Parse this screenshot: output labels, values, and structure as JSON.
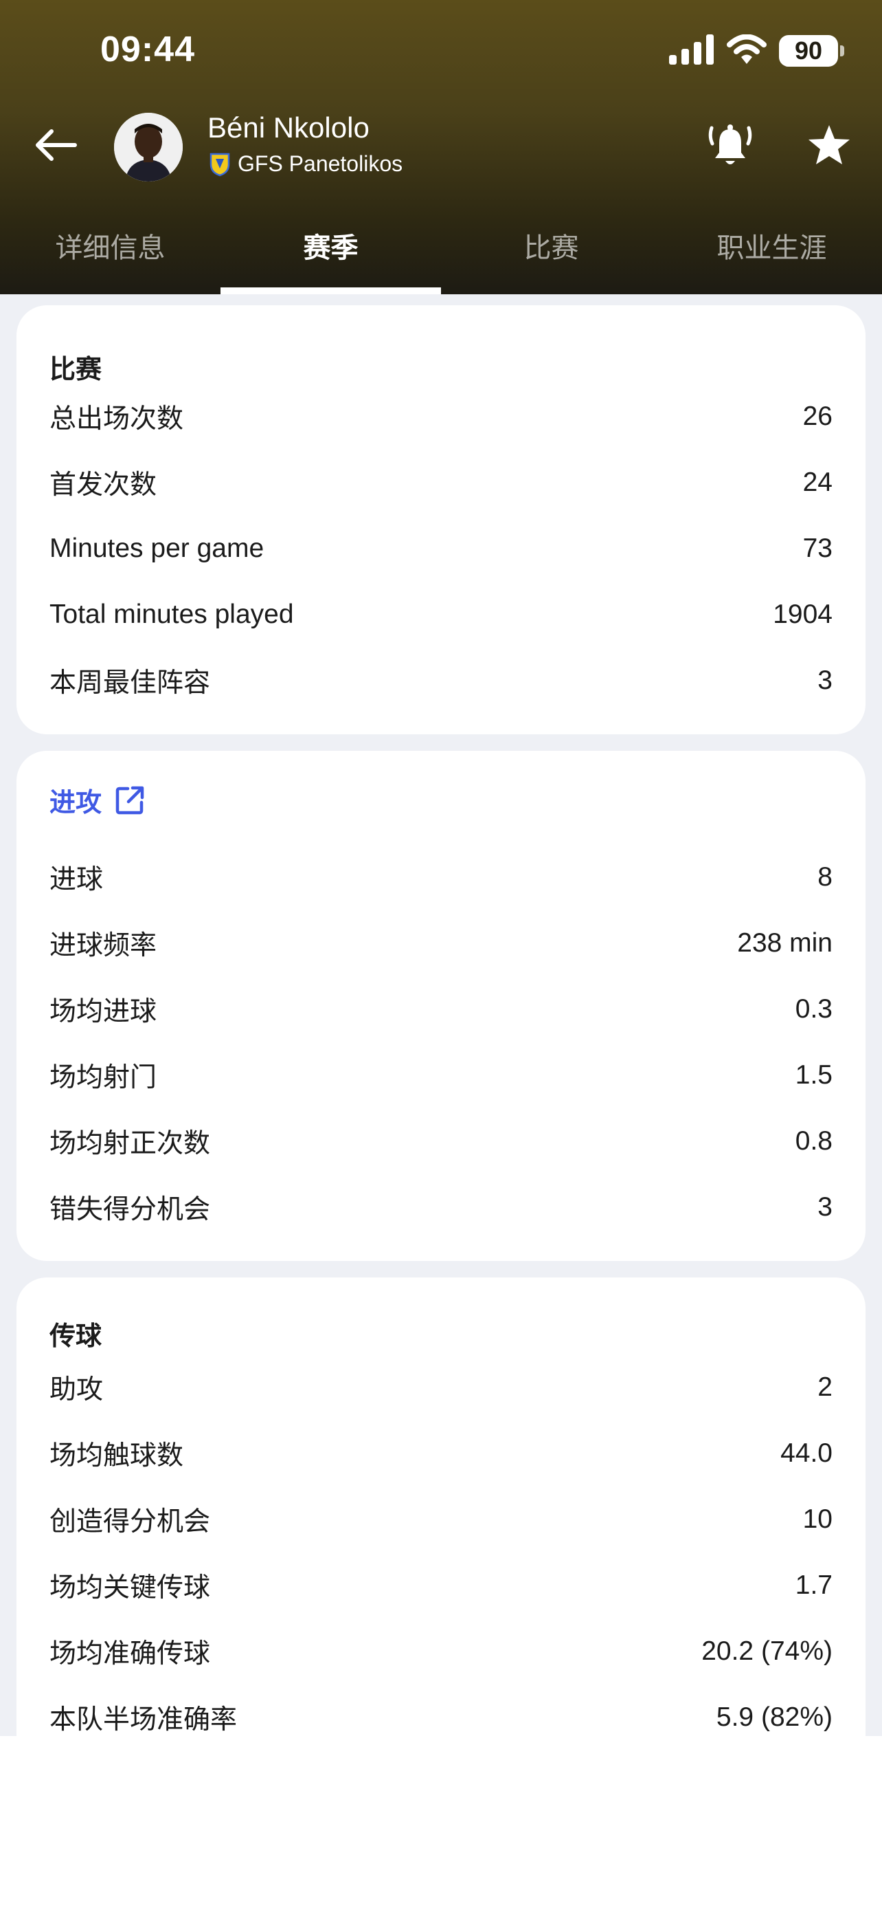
{
  "status_bar": {
    "time": "09:44",
    "battery": "90",
    "icons": [
      "signal-icon",
      "wifi-icon",
      "battery-icon"
    ]
  },
  "header": {
    "player_name": "Béni Nkololo",
    "club_name": "GFS Panetolikos",
    "icons": [
      "back-arrow-icon",
      "club-crest-icon",
      "bell-icon",
      "star-icon"
    ]
  },
  "tabs": [
    {
      "label": "详细信息",
      "active": false
    },
    {
      "label": "赛季",
      "active": true
    },
    {
      "label": "比赛",
      "active": false
    },
    {
      "label": "职业生涯",
      "active": false
    }
  ],
  "sections": [
    {
      "title": "比赛",
      "rows": [
        {
          "label": "总出场次数",
          "value": "26"
        },
        {
          "label": "首发次数",
          "value": "24"
        },
        {
          "label": "Minutes per game",
          "value": "73"
        },
        {
          "label": "Total minutes played",
          "value": "1904"
        },
        {
          "label": "本周最佳阵容",
          "value": "3"
        }
      ]
    },
    {
      "title": "进攻",
      "title_icon": "external-link-icon",
      "rows": [
        {
          "label": "进球",
          "value": "8"
        },
        {
          "label": "进球频率",
          "value": "238 min"
        },
        {
          "label": "场均进球",
          "value": "0.3"
        },
        {
          "label": "场均射门",
          "value": "1.5"
        },
        {
          "label": "场均射正次数",
          "value": "0.8"
        },
        {
          "label": "错失得分机会",
          "value": "3"
        }
      ]
    },
    {
      "title": "传球",
      "rows": [
        {
          "label": "助攻",
          "value": "2"
        },
        {
          "label": "场均触球数",
          "value": "44.0"
        },
        {
          "label": "创造得分机会",
          "value": "10"
        },
        {
          "label": "场均关键传球",
          "value": "1.7"
        },
        {
          "label": "场均准确传球",
          "value": "20.2 (74%)"
        },
        {
          "label": "本队半场准确率",
          "value": "5.9 (82%)"
        }
      ]
    }
  ],
  "colors": {
    "header_gradient_top": "#5b4d1a",
    "header_gradient_bottom": "#1d1b13",
    "link_blue": "#3f59e4",
    "page_bg": "#eef0f5",
    "card_bg": "#ffffff"
  }
}
